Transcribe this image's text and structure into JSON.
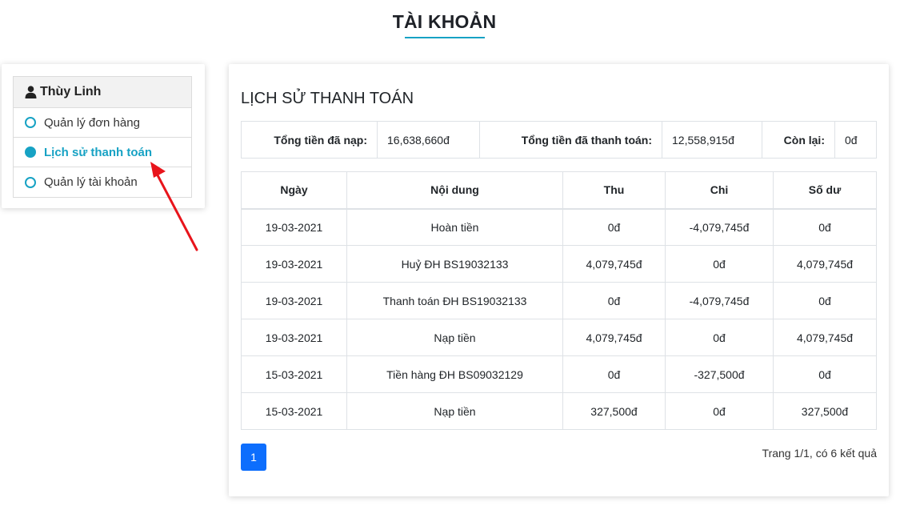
{
  "page": {
    "title": "TÀI KHOẢN"
  },
  "sidebar": {
    "user_name": "Thùy Linh",
    "items": [
      {
        "label": "Quản lý đơn hàng",
        "active": false
      },
      {
        "label": "Lịch sử thanh toán",
        "active": true
      },
      {
        "label": "Quản lý tài khoản",
        "active": false
      }
    ]
  },
  "main": {
    "title": "LỊCH SỬ THANH TOÁN",
    "summary": {
      "deposited_label": "Tổng tiền đã nạp:",
      "deposited_value": "16,638,660đ",
      "paid_label": "Tổng tiền đã thanh toán:",
      "paid_value": "12,558,915đ",
      "remaining_label": "Còn lại:",
      "remaining_value": "0đ"
    },
    "table": {
      "headers": [
        "Ngày",
        "Nội dung",
        "Thu",
        "Chi",
        "Số dư"
      ],
      "rows": [
        [
          "19-03-2021",
          "Hoàn tiền",
          "0đ",
          "-4,079,745đ",
          "0đ"
        ],
        [
          "19-03-2021",
          "Huỷ ĐH BS19032133",
          "4,079,745đ",
          "0đ",
          "4,079,745đ"
        ],
        [
          "19-03-2021",
          "Thanh toán ĐH BS19032133",
          "0đ",
          "-4,079,745đ",
          "0đ"
        ],
        [
          "19-03-2021",
          "Nạp tiền",
          "4,079,745đ",
          "0đ",
          "4,079,745đ"
        ],
        [
          "15-03-2021",
          "Tiền hàng ĐH BS09032129",
          "0đ",
          "-327,500đ",
          "0đ"
        ],
        [
          "15-03-2021",
          "Nạp tiền",
          "327,500đ",
          "0đ",
          "327,500đ"
        ]
      ]
    },
    "pagination": {
      "current_page": "1",
      "info": "Trang 1/1, có 6 kết quả"
    }
  },
  "colors": {
    "accent": "#17a2c4",
    "primary_button": "#0d6efd",
    "annotation_arrow": "#e8141b"
  }
}
